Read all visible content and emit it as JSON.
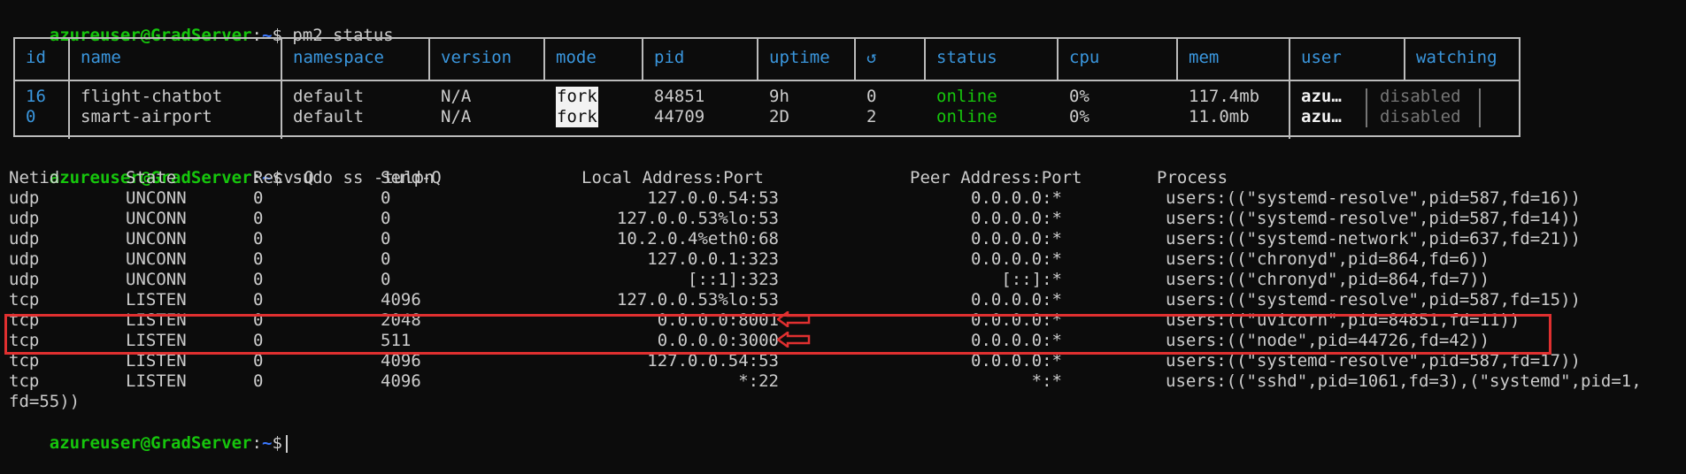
{
  "prompt": {
    "user": "azureuser@GradServer",
    "colon": ":",
    "path": "~",
    "sign": "$"
  },
  "commands": {
    "pm2": "pm2 status",
    "ss": "sudo ss -tulpn"
  },
  "pm2": {
    "headers": [
      "id",
      "name",
      "namespace",
      "version",
      "mode",
      "pid",
      "uptime",
      "↺",
      "status",
      "cpu",
      "mem",
      "user",
      "watching"
    ],
    "rows": [
      {
        "id": "16",
        "name": "flight-chatbot",
        "namespace": "default",
        "version": "N/A",
        "mode": "fork",
        "pid": "84851",
        "uptime": "9h",
        "restarts": "0",
        "status": "online",
        "cpu": "0%",
        "mem": "117.4mb",
        "user": "azu…",
        "watching": "disabled"
      },
      {
        "id": "0",
        "name": "smart-airport",
        "namespace": "default",
        "version": "N/A",
        "mode": "fork",
        "pid": "44709",
        "uptime": "2D",
        "restarts": "2",
        "status": "online",
        "cpu": "0%",
        "mem": "11.0mb",
        "user": "azu…",
        "watching": "disabled"
      }
    ]
  },
  "ss": {
    "headers": {
      "netid": "Netid",
      "state": "State",
      "recvq": "Recv-Q",
      "sendq": "Send-Q",
      "local": "Local Address:Port",
      "peer": "Peer Address:Port",
      "process": "Process"
    },
    "rows": [
      {
        "netid": "udp",
        "state": "UNCONN",
        "recvq": "0",
        "sendq": "0",
        "local": "127.0.0.54:53",
        "peer": "0.0.0.0:*",
        "process": "users:((\"systemd-resolve\",pid=587,fd=16))"
      },
      {
        "netid": "udp",
        "state": "UNCONN",
        "recvq": "0",
        "sendq": "0",
        "local": "127.0.0.53%lo:53",
        "peer": "0.0.0.0:*",
        "process": "users:((\"systemd-resolve\",pid=587,fd=14))"
      },
      {
        "netid": "udp",
        "state": "UNCONN",
        "recvq": "0",
        "sendq": "0",
        "local": "10.2.0.4%eth0:68",
        "peer": "0.0.0.0:*",
        "process": "users:((\"systemd-network\",pid=637,fd=21))"
      },
      {
        "netid": "udp",
        "state": "UNCONN",
        "recvq": "0",
        "sendq": "0",
        "local": "127.0.0.1:323",
        "peer": "0.0.0.0:*",
        "process": "users:((\"chronyd\",pid=864,fd=6))"
      },
      {
        "netid": "udp",
        "state": "UNCONN",
        "recvq": "0",
        "sendq": "0",
        "local": "[::1]:323",
        "peer": "[::]:*",
        "process": "users:((\"chronyd\",pid=864,fd=7))"
      },
      {
        "netid": "tcp",
        "state": "LISTEN",
        "recvq": "0",
        "sendq": "4096",
        "local": "127.0.0.53%lo:53",
        "peer": "0.0.0.0:*",
        "process": "users:((\"systemd-resolve\",pid=587,fd=15))"
      },
      {
        "netid": "tcp",
        "state": "LISTEN",
        "recvq": "0",
        "sendq": "2048",
        "local": "0.0.0.0:8001",
        "peer": "0.0.0.0:*",
        "process": "users:((\"uvicorn\",pid=84851,fd=11))"
      },
      {
        "netid": "tcp",
        "state": "LISTEN",
        "recvq": "0",
        "sendq": "511",
        "local": "0.0.0.0:3000",
        "peer": "0.0.0.0:*",
        "process": "users:((\"node\",pid=44726,fd=42))"
      },
      {
        "netid": "tcp",
        "state": "LISTEN",
        "recvq": "0",
        "sendq": "4096",
        "local": "127.0.0.54:53",
        "peer": "0.0.0.0:*",
        "process": "users:((\"systemd-resolve\",pid=587,fd=17))"
      },
      {
        "netid": "tcp",
        "state": "LISTEN",
        "recvq": "0",
        "sendq": "4096",
        "local": "*:22",
        "peer": "*:*",
        "process": "users:((\"sshd\",pid=1061,fd=3),(\"systemd\",pid=1,"
      }
    ],
    "wrap": "fd=55))"
  },
  "colors": {
    "prompt_user": "#16c60c",
    "prompt_path": "#3b78ff",
    "header": "#3a96dd",
    "online": "#16c60c",
    "highlight": "#e03030"
  }
}
